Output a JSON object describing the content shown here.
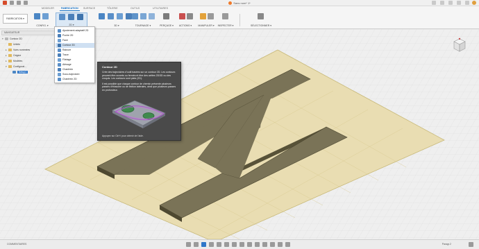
{
  "window": {
    "title": "Sans nom* 1*"
  },
  "ribbon": {
    "tabs": [
      "MODELER",
      "SURFACE",
      "TÔLERIE",
      "OUTILS",
      "FABRICATION",
      "UTILITAIRES"
    ],
    "active_tab": "FABRICATION",
    "workspace_button": "FABRICATION ▾",
    "groups": [
      {
        "label": "CONFIG. ▾"
      },
      {
        "label": "2D ▾"
      },
      {
        "label": "3D ▾"
      },
      {
        "label": "TOURNAGE ▾"
      },
      {
        "label": "PERÇAGE ▾"
      },
      {
        "label": "ACTIONS ▾"
      },
      {
        "label": "MANIPULER ▾"
      },
      {
        "label": "INSPECTER ▾"
      },
      {
        "label": "SÉLECTIONNER ▾"
      }
    ],
    "accent": "#0a6bc4"
  },
  "browser": {
    "header": "NAVIGATEUR",
    "items": [
      {
        "label": "Contour 2D"
      },
      {
        "label": "Unités"
      },
      {
        "label": "Vues nommées"
      },
      {
        "label": "Origine"
      },
      {
        "label": "Modèles"
      },
      {
        "label": "Configurat..."
      },
      {
        "label": "Setup1"
      }
    ]
  },
  "dropdown": {
    "items": [
      {
        "label": "Ajustement adaptatif 2D"
      },
      {
        "label": "Poche 2D"
      },
      {
        "label": "Face"
      },
      {
        "label": "Contour 2D"
      },
      {
        "label": "Rainure"
      },
      {
        "label": "Trace"
      },
      {
        "label": "Filetage"
      },
      {
        "label": "Alésage"
      },
      {
        "label": "Chanfrein"
      },
      {
        "label": "Sous-trajectoire"
      },
      {
        "label": "Chanfrein 2D"
      }
    ],
    "highlighted": "Contour 2D"
  },
  "tooltip": {
    "title": "Contour 2D",
    "paragraph1": "Crée des trajectoires d'outil basées sur un contour 2D. Les contours peuvent être ouverts ou fermés et être des arêtes 2D/3D ou des croquis. Les contours sont plats (2D).",
    "paragraph2": "Il est possible que chaque contour de chemin présente plusieurs passes d'ébauche ou de finition latérales, ainsi que plusieurs passes en profondeur.",
    "footer": "Appuyez sur Ctrl+/ pour obtenir de l'aide."
  },
  "statusbar": {
    "comments_label": "COMMENTAIRES",
    "timeline_label": "Paragr.2"
  },
  "colors": {
    "plate": "#e9ddb2",
    "letter_top": "#7a7357",
    "letter_side": "#585238",
    "tooltip_bg": "#4a4a4a",
    "selection": "#2f77c9"
  }
}
